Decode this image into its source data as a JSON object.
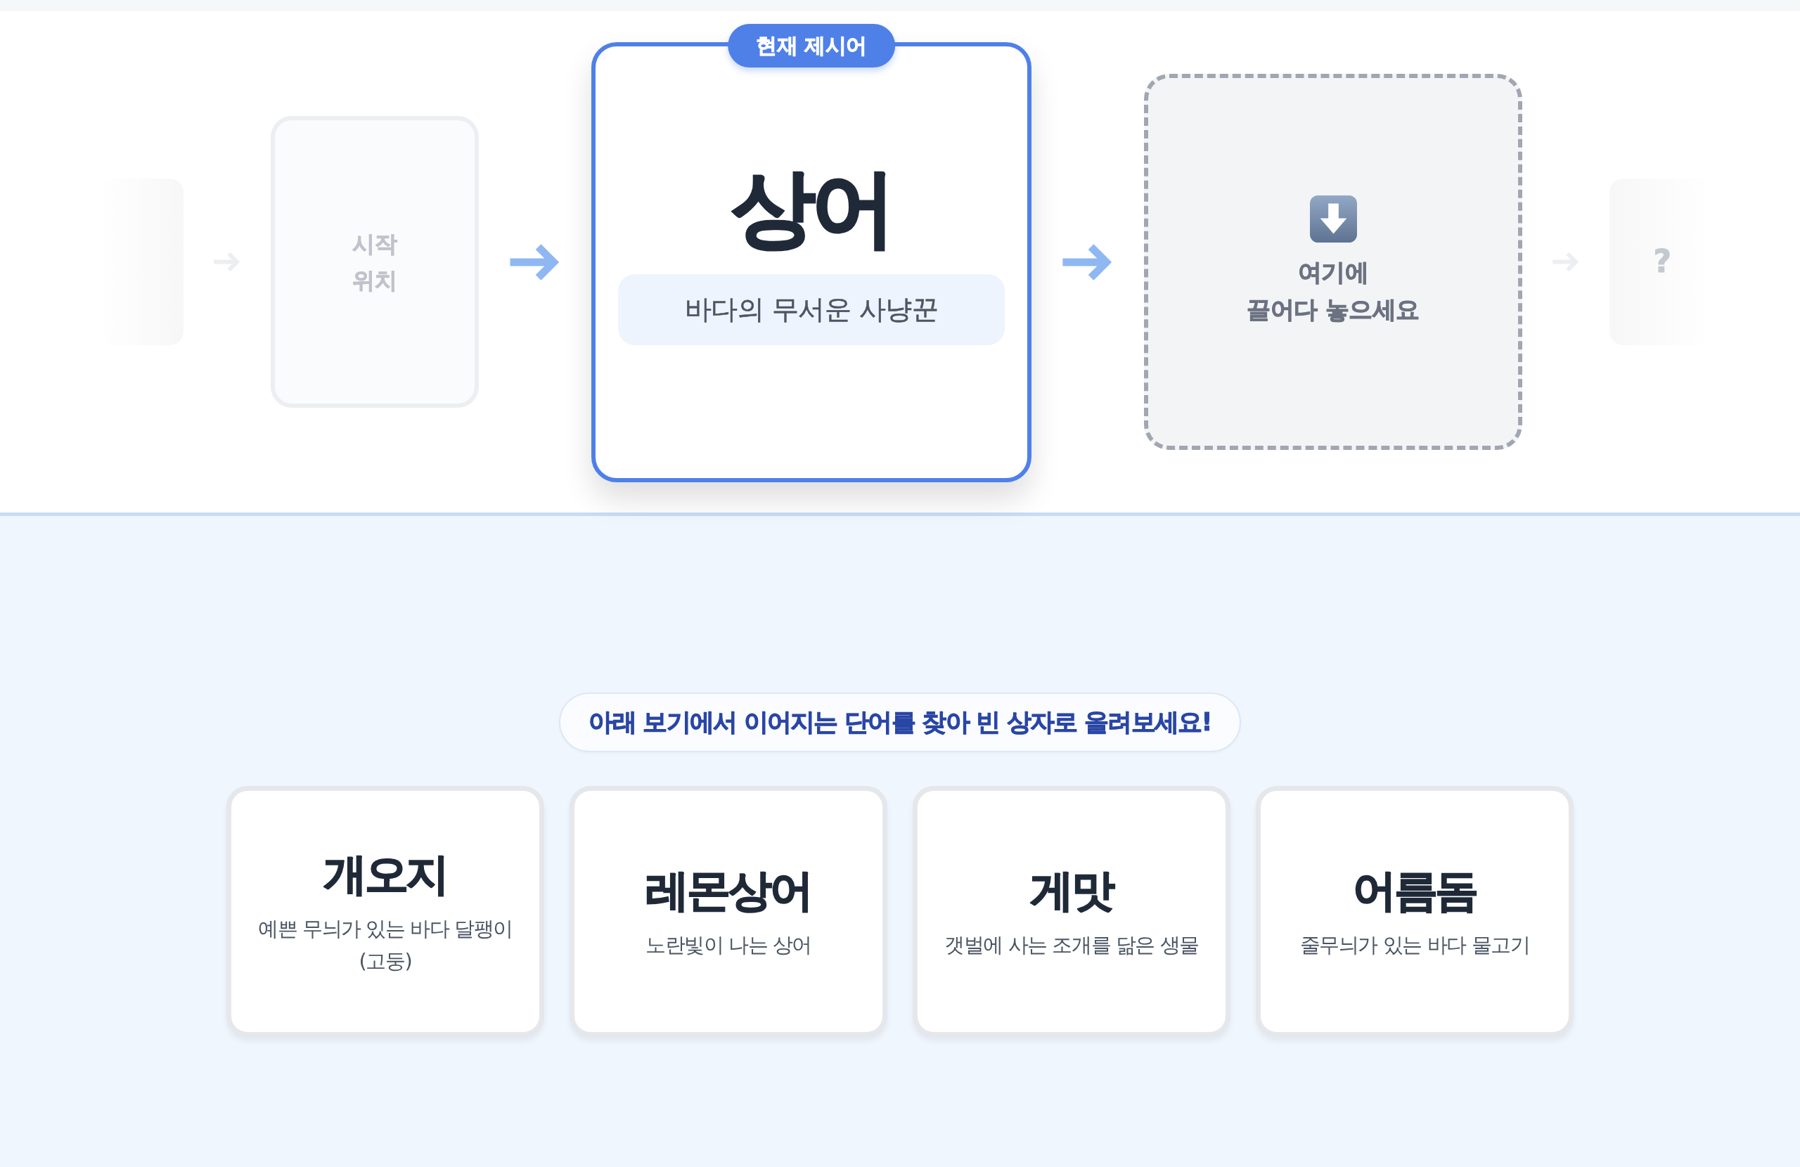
{
  "chain": [
    {
      "kind": "past"
    },
    {
      "kind": "start",
      "label": "시작\n위치"
    },
    {
      "kind": "current",
      "badge": "현재 제시어",
      "word": "상어",
      "hint": "바다의 무서운 사냥꾼"
    },
    {
      "kind": "slot",
      "prompt": "여기에\n끌어다 놓으세요"
    },
    {
      "kind": "future",
      "label": "?"
    }
  ],
  "instruction": "아래 보기에서 이어지는 단어를 찾아 빈 상자로 올려보세요!",
  "options": [
    {
      "word": "개오지",
      "hint": "예쁜 무늬가 있는 바다 달팽이 (고둥)"
    },
    {
      "word": "레몬상어",
      "hint": "노란빛이 나는 상어"
    },
    {
      "word": "게맛",
      "hint": "갯벌에 사는 조개를 닮은 생물"
    },
    {
      "word": "어름돔",
      "hint": "줄무늬가 있는 바다 물고기"
    }
  ]
}
